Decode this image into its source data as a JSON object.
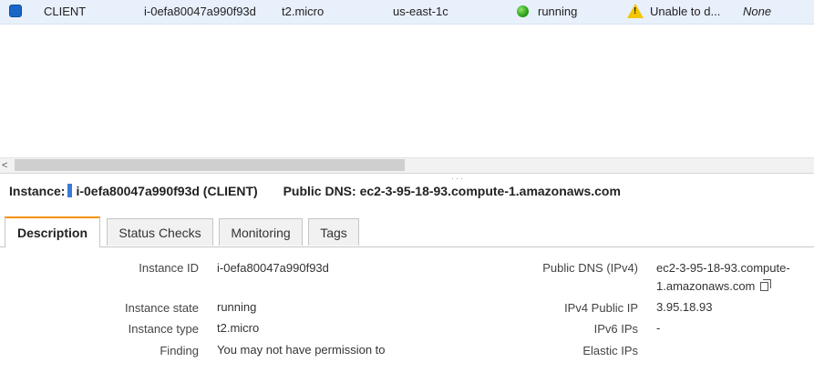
{
  "instance_row": {
    "name": "CLIENT",
    "instance_id": "i-0efa80047a990f93d",
    "instance_type": "t2.micro",
    "availability_zone": "us-east-1c",
    "state": "running",
    "status_check": "Unable to d...",
    "alarm_status": "None"
  },
  "summary": {
    "instance_label": "Instance:",
    "instance_value": "i-0efa80047a990f93d (CLIENT)",
    "dns_label": "Public DNS:",
    "dns_value": "ec2-3-95-18-93.compute-1.amazonaws.com"
  },
  "tabs": [
    {
      "label": "Description"
    },
    {
      "label": "Status Checks"
    },
    {
      "label": "Monitoring"
    },
    {
      "label": "Tags"
    }
  ],
  "details_left": [
    {
      "label": "Instance ID",
      "value": "i-0efa80047a990f93d"
    },
    {
      "label": "Instance state",
      "value": "running"
    },
    {
      "label": "Instance type",
      "value": "t2.micro"
    },
    {
      "label": "Finding",
      "value": "You may not have permission to"
    }
  ],
  "details_right": [
    {
      "label": "Public DNS (IPv4)",
      "value_line1": "ec2-3-95-18-93.compute-",
      "value_line2": "1.amazonaws.com"
    },
    {
      "label": "IPv4 Public IP",
      "value": "3.95.18.93"
    },
    {
      "label": "IPv6 IPs",
      "value": "-"
    },
    {
      "label": "Elastic IPs",
      "value": ""
    }
  ],
  "icons": {
    "state": "green-circle-icon",
    "status_check": "warning-triangle-icon",
    "copy": "copy-icon"
  },
  "colors": {
    "selected_row": "#e8f0fb",
    "active_tab_accent": "#f39200",
    "running": "#2aa11a",
    "warning": "#f3c600",
    "marker": "#3a7bd5"
  }
}
